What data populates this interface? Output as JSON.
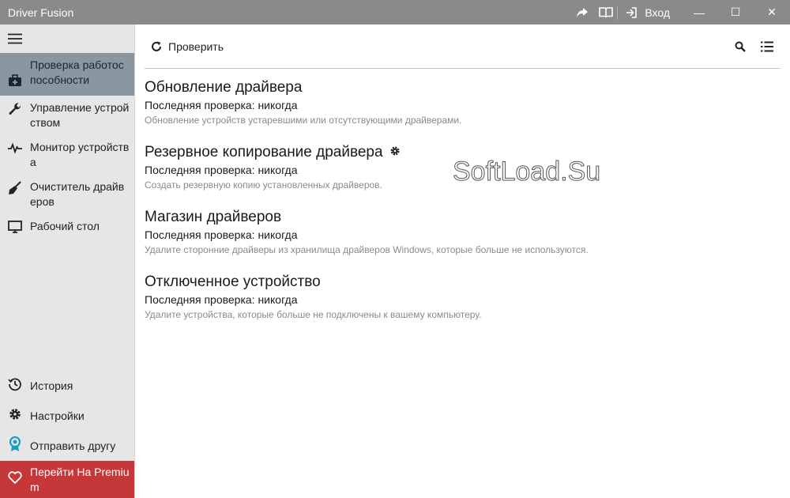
{
  "window": {
    "title": "Driver Fusion",
    "login_label": "Вход",
    "minimize": "—",
    "maximize": "☐",
    "close": "✕"
  },
  "sidebar": {
    "items": [
      {
        "label": "Проверка работоспособности",
        "icon": "toolbox-icon",
        "active": true
      },
      {
        "label": "Управление устройством",
        "icon": "wrench-icon"
      },
      {
        "label": "Монитор устройства",
        "icon": "pulse-icon"
      },
      {
        "label": "Очиститель драйверов",
        "icon": "broom-icon"
      },
      {
        "label": "Рабочий стол",
        "icon": "monitor-icon"
      }
    ],
    "bottom_items": [
      {
        "label": "История",
        "icon": "history-icon"
      },
      {
        "label": "Настройки",
        "icon": "gear-icon"
      },
      {
        "label": "Отправить другу",
        "icon": "award-icon"
      },
      {
        "label": "Перейти На Premium",
        "icon": "heart-icon"
      }
    ]
  },
  "toolbar": {
    "refresh_label": "Проверить"
  },
  "sections": [
    {
      "title": "Обновление драйвера",
      "last_check": "Последняя проверка: никогда",
      "description": "Обновление устройств устаревшими или отсутствующими драйверами."
    },
    {
      "title": "Резервное копирование драйвера",
      "last_check": "Последняя проверка: никогда",
      "description": "Создать резервную копию установленных драйверов."
    },
    {
      "title": "Магазин драйверов",
      "last_check": "Последняя проверка: никогда",
      "description": "Удалите сторонние драйверы из хранилища драйверов Windows, которые больше не используются."
    },
    {
      "title": "Отключенное устройство",
      "last_check": "Последняя проверка: никогда",
      "description": "Удалите устройства, которые больше не подключены к вашему компьютеру."
    }
  ],
  "watermark": "SoftLoad.Su",
  "colors": {
    "titlebar": "#8a8a8a",
    "sidebar": "#e6e6e6",
    "active_item": "#8a97a1",
    "premium": "#c6373a"
  }
}
